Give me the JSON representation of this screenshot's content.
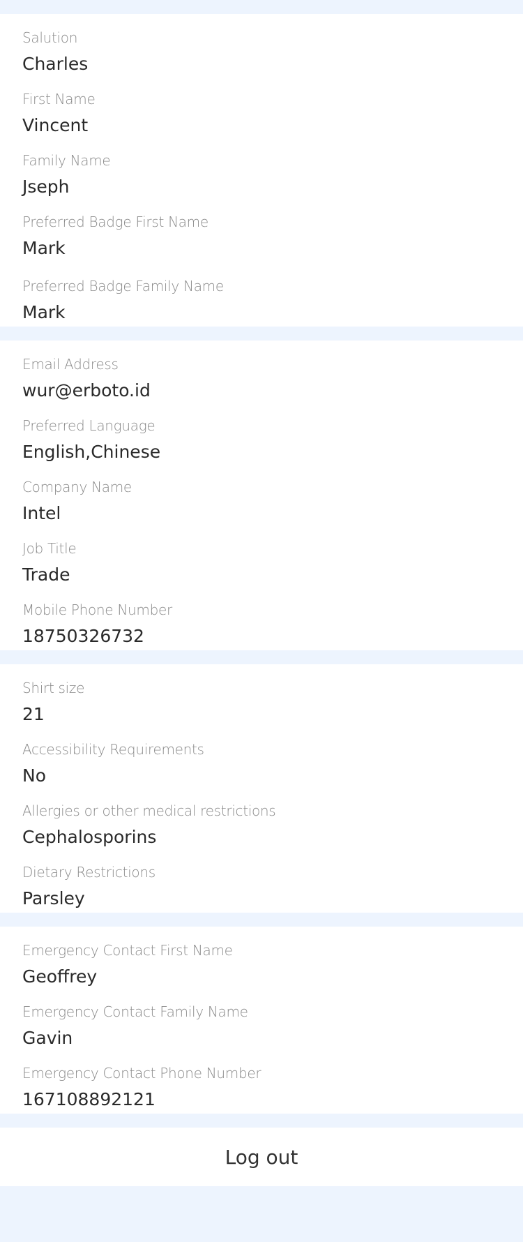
{
  "sections": [
    {
      "fields": [
        {
          "label": "Salution",
          "value": "Charles"
        },
        {
          "label": "First Name",
          "value": "Vincent"
        },
        {
          "label": "Family Name",
          "value": "Jseph"
        },
        {
          "label": "Preferred Badge First Name",
          "value": "Mark"
        },
        {
          "label": "Preferred Badge Family Name",
          "value": "Mark"
        }
      ]
    },
    {
      "fields": [
        {
          "label": "Email Address",
          "value": "wur@erboto.id"
        },
        {
          "label": "Preferred Language",
          "value": "English,Chinese"
        },
        {
          "label": "Company Name",
          "value": "Intel"
        },
        {
          "label": "Job Title",
          "value": "Trade"
        },
        {
          "label": "Mobile Phone Number",
          "value": "18750326732"
        }
      ]
    },
    {
      "fields": [
        {
          "label": "Shirt size",
          "value": "21"
        },
        {
          "label": "Accessibility Requirements",
          "value": "No"
        },
        {
          "label": "Allergies or other medical restrictions",
          "value": "Cephalosporins"
        },
        {
          "label": "Dietary Restrictions",
          "value": "Parsley"
        }
      ]
    },
    {
      "fields": [
        {
          "label": "Emergency Contact First Name",
          "value": "Geoffrey"
        },
        {
          "label": "Emergency Contact Family Name",
          "value": "Gavin"
        },
        {
          "label": "Emergency Contact Phone Number",
          "value": "167108892121"
        }
      ]
    }
  ],
  "logout_label": "Log out"
}
